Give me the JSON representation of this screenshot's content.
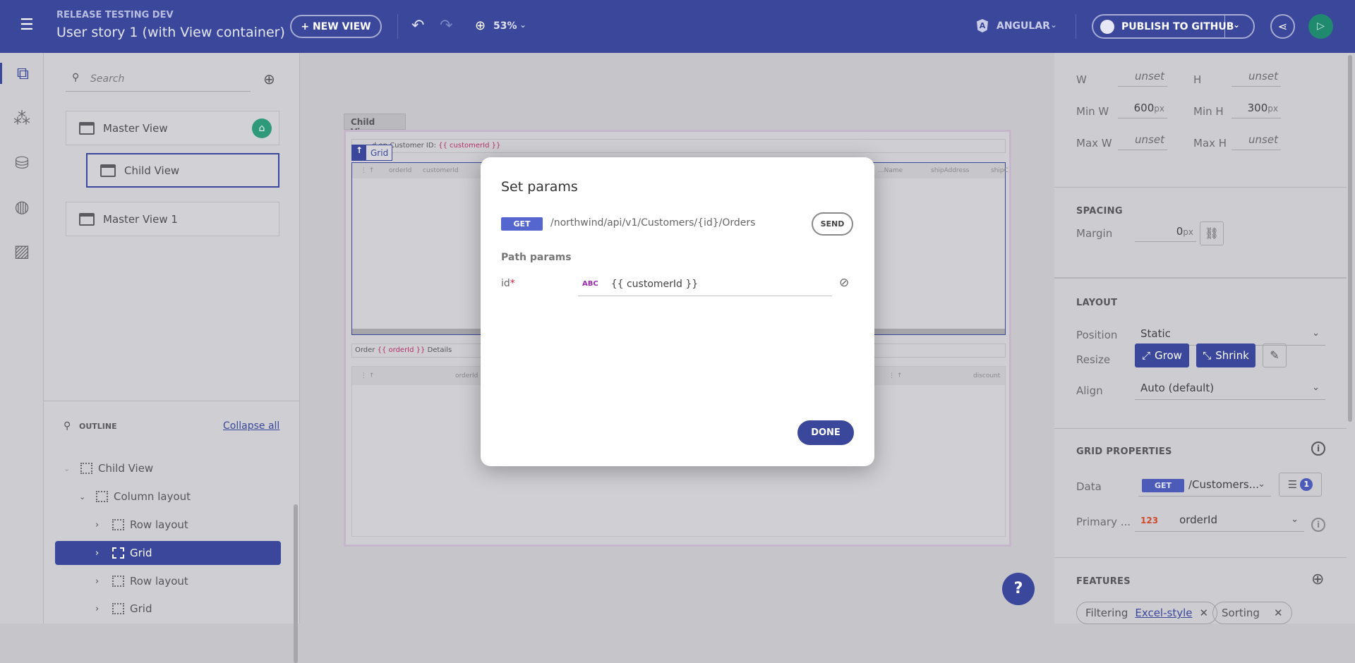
{
  "header": {
    "project": "RELEASE TESTING DEV",
    "title": "User story 1 (with View container)",
    "new_view": "+ NEW VIEW",
    "zoom": "53%",
    "framework": "ANGULAR",
    "publish": "PUBLISH TO GITHUB"
  },
  "left": {
    "search_placeholder": "Search",
    "views": [
      "Master View",
      "Child View",
      "Master View 1"
    ],
    "outline_label": "OUTLINE",
    "collapse_all": "Collapse all",
    "tree": [
      "Child View",
      "Column layout",
      "Row layout",
      "Grid",
      "Row layout",
      "Grid"
    ]
  },
  "canvas": {
    "view_tab": "Child View",
    "grid_badge": "Grid",
    "text1_prefix": "d on Customer ID: ",
    "text1_bind": "{{ customerId }}",
    "text2_prefix": "Order ",
    "text2_bind": "{{ orderId }}",
    "text2_suffix": " Details",
    "grid1_cols": [
      "orderId",
      "customerId",
      "...Name",
      "shipAddress",
      "shipC"
    ],
    "grid2_cols": [
      "orderId",
      "discount"
    ]
  },
  "dialog": {
    "title": "Set params",
    "method": "GET",
    "url": "/northwind/api/v1/Customers/{id}/Orders",
    "send": "SEND",
    "path_params": "Path params",
    "param_name": "id",
    "required": "*",
    "type": "ABC",
    "param_value": "{{ customerId }}",
    "done": "DONE"
  },
  "right": {
    "w_label": "W",
    "w_val": "unset",
    "h_label": "H",
    "h_val": "unset",
    "minw_label": "Min W",
    "minw_val": "600",
    "minh_label": "Min H",
    "minh_val": "300",
    "unit": "px",
    "maxw_label": "Max W",
    "maxw_val": "unset",
    "maxh_label": "Max H",
    "maxh_val": "unset",
    "spacing": "SPACING",
    "margin_label": "Margin",
    "margin_val": "0",
    "layout": "LAYOUT",
    "position_label": "Position",
    "position_val": "Static",
    "resize_label": "Resize",
    "grow": "Grow",
    "shrink": "Shrink",
    "align_label": "Align",
    "align_val": "Auto (default)",
    "grid_props": "GRID PROPERTIES",
    "data_label": "Data",
    "data_method": "GET",
    "data_val": "/Customers...",
    "params_count": "1",
    "primary_label": "Primary ...",
    "primary_type": "123",
    "primary_val": "orderId",
    "features": "FEATURES",
    "chips": [
      {
        "label": "Filtering",
        "link": "Excel-style"
      },
      {
        "label": "Sorting"
      }
    ]
  },
  "help": "?"
}
